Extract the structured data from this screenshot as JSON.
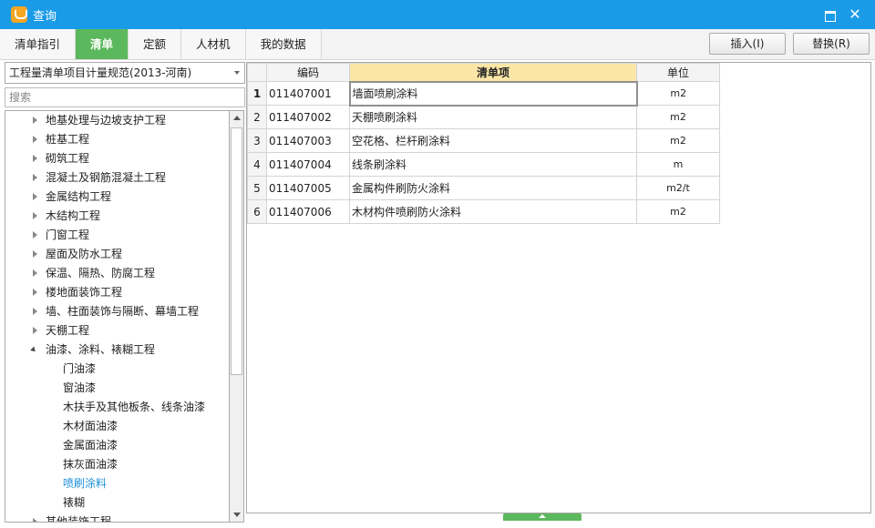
{
  "window": {
    "title": "查询"
  },
  "tabs": [
    {
      "label": "清单指引"
    },
    {
      "label": "清单",
      "active": true
    },
    {
      "label": "定额"
    },
    {
      "label": "人材机"
    },
    {
      "label": "我的数据"
    }
  ],
  "toolbar": {
    "insert_label": "插入(I)",
    "replace_label": "替换(R)"
  },
  "left": {
    "spec_select": "工程量清单项目计量规范(2013-河南)",
    "search_placeholder": "搜索",
    "tree": [
      {
        "label": "地基处理与边坡支护工程",
        "level": 0,
        "state": "collapsed"
      },
      {
        "label": "桩基工程",
        "level": 0,
        "state": "collapsed"
      },
      {
        "label": "砌筑工程",
        "level": 0,
        "state": "collapsed"
      },
      {
        "label": "混凝土及钢筋混凝土工程",
        "level": 0,
        "state": "collapsed"
      },
      {
        "label": "金属结构工程",
        "level": 0,
        "state": "collapsed"
      },
      {
        "label": "木结构工程",
        "level": 0,
        "state": "collapsed"
      },
      {
        "label": "门窗工程",
        "level": 0,
        "state": "collapsed"
      },
      {
        "label": "屋面及防水工程",
        "level": 0,
        "state": "collapsed"
      },
      {
        "label": "保温、隔热、防腐工程",
        "level": 0,
        "state": "collapsed"
      },
      {
        "label": "楼地面装饰工程",
        "level": 0,
        "state": "collapsed"
      },
      {
        "label": "墙、柱面装饰与隔断、幕墙工程",
        "level": 0,
        "state": "collapsed"
      },
      {
        "label": "天棚工程",
        "level": 0,
        "state": "collapsed"
      },
      {
        "label": "油漆、涂料、裱糊工程",
        "level": 0,
        "state": "expanded"
      },
      {
        "label": "门油漆",
        "level": 1
      },
      {
        "label": "窗油漆",
        "level": 1
      },
      {
        "label": "木扶手及其他板条、线条油漆",
        "level": 1
      },
      {
        "label": "木材面油漆",
        "level": 1
      },
      {
        "label": "金属面油漆",
        "level": 1
      },
      {
        "label": "抹灰面油漆",
        "level": 1
      },
      {
        "label": "喷刷涂料",
        "level": 1,
        "selected": true
      },
      {
        "label": "裱糊",
        "level": 1
      },
      {
        "label": "其他装饰工程",
        "level": 0,
        "state": "collapsed"
      }
    ]
  },
  "grid": {
    "headers": {
      "code": "编码",
      "name": "清单项",
      "unit": "单位"
    },
    "rows": [
      {
        "no": "1",
        "code": "011407001",
        "name": "墙面喷刷涂料",
        "unit": "m2"
      },
      {
        "no": "2",
        "code": "011407002",
        "name": "天棚喷刷涂料",
        "unit": "m2"
      },
      {
        "no": "3",
        "code": "011407003",
        "name": "空花格、栏杆刷涂料",
        "unit": "m2"
      },
      {
        "no": "4",
        "code": "011407004",
        "name": "线条刷涂料",
        "unit": "m"
      },
      {
        "no": "5",
        "code": "011407005",
        "name": "金属构件刷防火涂料",
        "unit": "m2/t"
      },
      {
        "no": "6",
        "code": "011407006",
        "name": "木材构件喷刷防火涂料",
        "unit": "m2"
      }
    ]
  },
  "colors": {
    "title_bar": "#1a9be8",
    "active_tab": "#5cb85c",
    "header_highlight": "#fbe6a8",
    "selected_tree_text": "#1a8fd8"
  }
}
